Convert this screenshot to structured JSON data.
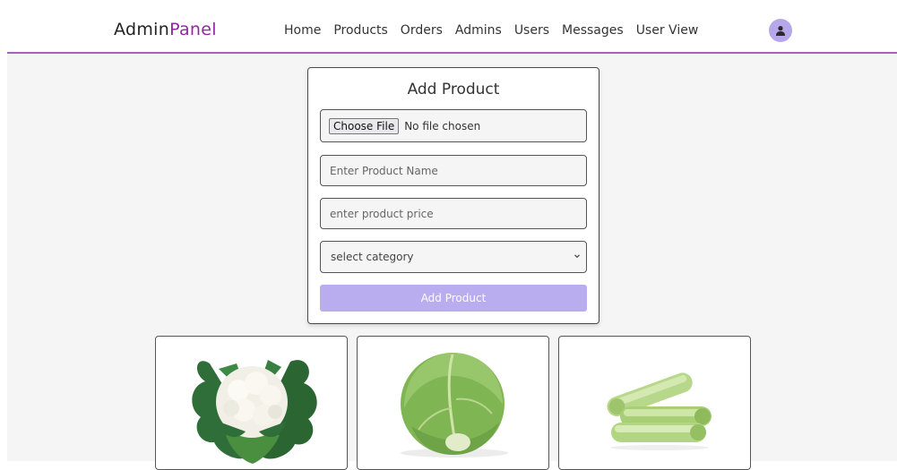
{
  "header": {
    "logo_part1": "Admin",
    "logo_part2": "Panel",
    "nav": [
      "Home",
      "Products",
      "Orders",
      "Admins",
      "Users",
      "Messages",
      "User View"
    ],
    "avatar_icon": "user-icon"
  },
  "colors": {
    "accent": "#8e2a9c",
    "header_border": "#a463b5",
    "button": "#b9acef",
    "avatar": "#b6a7ea",
    "page_bg": "#f5f5f5"
  },
  "form": {
    "title": "Add Product",
    "file_button": "Choose File",
    "file_status": "No file chosen",
    "name_placeholder": "Enter Product Name",
    "price_placeholder": "enter product price",
    "category_selected": "select category",
    "submit_label": "Add Product"
  },
  "products": [
    {
      "image_icon": "cauliflower-image"
    },
    {
      "image_icon": "cabbage-image"
    },
    {
      "image_icon": "cucumber-image"
    }
  ]
}
